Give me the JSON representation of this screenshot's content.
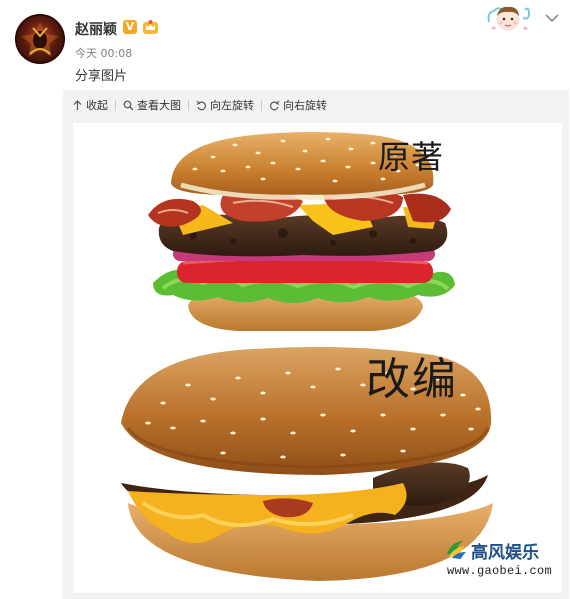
{
  "post": {
    "username": "赵丽颖",
    "verified_mark": "V",
    "time": "今天 00:08",
    "text": "分享图片"
  },
  "toolbar": {
    "collapse": "收起",
    "view_large": "查看大图",
    "rotate_left": "向左旋转",
    "rotate_right": "向右旋转"
  },
  "image": {
    "label_top": "原著",
    "label_bottom": "改编"
  },
  "watermark": {
    "name": "高风娱乐",
    "url": "www.gaobei.com"
  },
  "colors": {
    "panel_bg": "#f2f2f5",
    "verified_badge": "#f5a623",
    "watermark_blue": "#1d4f8c"
  },
  "icons": [
    "avatar",
    "verified-v-icon",
    "crown-badge-icon",
    "sticker-avatar-icon",
    "chevron-down-icon",
    "collapse-up-icon",
    "zoom-search-icon",
    "rotate-left-icon",
    "rotate-right-icon",
    "watermark-logo-icon"
  ]
}
